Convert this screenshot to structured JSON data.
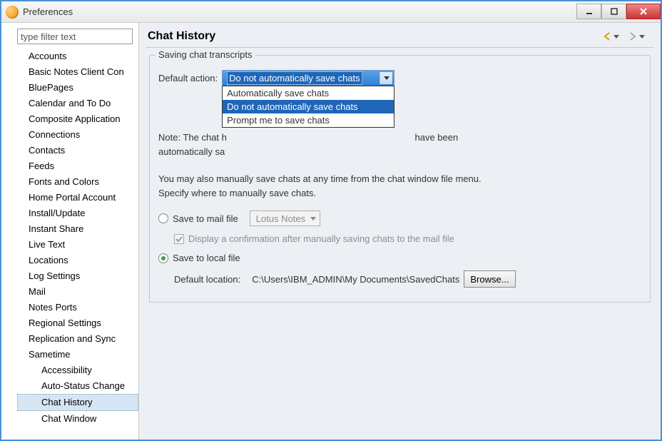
{
  "window": {
    "title": "Preferences"
  },
  "sidebar": {
    "filter_placeholder": "type filter text",
    "items": [
      "Accounts",
      "Basic Notes Client Con",
      "BluePages",
      "Calendar and To Do",
      "Composite Application",
      "Connections",
      "Contacts",
      "Feeds",
      "Fonts and Colors",
      "Home Portal Account",
      "Install/Update",
      "Instant Share",
      "Live Text",
      "Locations",
      "Log Settings",
      "Mail",
      "Notes Ports",
      "Regional Settings",
      "Replication and Sync",
      "Sametime"
    ],
    "children": [
      "Accessibility",
      "Auto-Status Change",
      "Chat History",
      "Chat Window"
    ],
    "selected_child": "Chat History"
  },
  "main": {
    "heading": "Chat History",
    "group_title": "Saving chat transcripts",
    "default_action_label": "Default action:",
    "default_action_value": "Do not automatically save chats",
    "default_action_options": [
      "Automatically save chats",
      "Do not automatically save chats",
      "Prompt me to save chats"
    ],
    "note_line1": "Note: The chat h",
    "note_line2": "automatically sa",
    "note_tail": " have been",
    "manual_text": "You may also manually save chats at any time from the chat window file menu. Specify where to manually save chats.",
    "save_mail_label": "Save to mail file",
    "mail_file_value": "Lotus Notes",
    "confirm_label": "Display a confirmation after manually saving chats to the mail file",
    "save_local_label": "Save to local file",
    "location_label": "Default location:",
    "location_value": "C:\\Users\\IBM_ADMIN\\My Documents\\SavedChats",
    "browse_label": "Browse..."
  }
}
